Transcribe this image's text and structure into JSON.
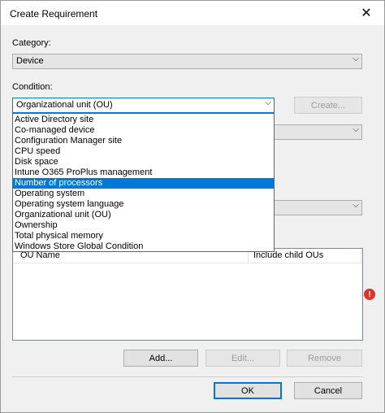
{
  "window": {
    "title": "Create Requirement"
  },
  "category": {
    "label": "Category:",
    "value": "Device"
  },
  "condition": {
    "label": "Condition:",
    "value": "Organizational unit (OU)",
    "create_label": "Create...",
    "options": [
      {
        "label": "Active Directory site"
      },
      {
        "label": "Co-managed device"
      },
      {
        "label": "Configuration Manager site"
      },
      {
        "label": "CPU speed"
      },
      {
        "label": "Disk space"
      },
      {
        "label": "Intune O365 ProPlus management"
      },
      {
        "label": "Number of processors",
        "selected": true
      },
      {
        "label": "Operating system"
      },
      {
        "label": "Operating system language"
      },
      {
        "label": "Organizational unit (OU)"
      },
      {
        "label": "Ownership"
      },
      {
        "label": "Total physical memory"
      },
      {
        "label": "Windows Store Global Condition"
      }
    ]
  },
  "ou_table": {
    "columns": [
      "OU Name",
      "Include child OUs"
    ],
    "rows": []
  },
  "list_buttons": {
    "add": "Add...",
    "edit": "Edit...",
    "remove": "Remove"
  },
  "footer": {
    "ok": "OK",
    "cancel": "Cancel"
  },
  "icons": {
    "close": "close-icon",
    "warning": "error-icon",
    "dropdown": "chevron-down-icon"
  },
  "colors": {
    "selection": "#0078d7",
    "warning": "#e0332e"
  }
}
